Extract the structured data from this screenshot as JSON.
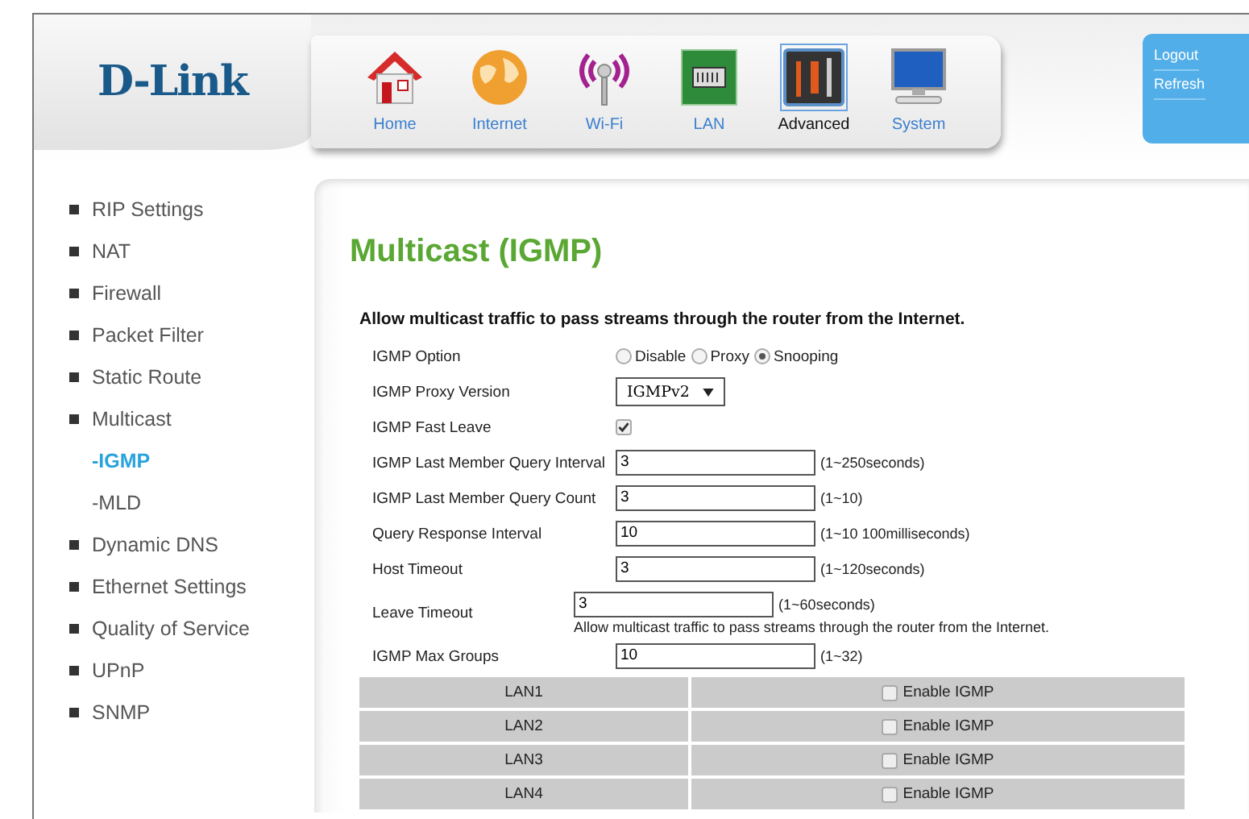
{
  "logo": "D-Link",
  "nav": [
    {
      "kind": "home",
      "label": "Home",
      "selected": false
    },
    {
      "kind": "internet",
      "label": "Internet",
      "selected": false
    },
    {
      "kind": "wifi",
      "label": "Wi-Fi",
      "selected": false
    },
    {
      "kind": "lan",
      "label": "LAN",
      "selected": false
    },
    {
      "kind": "advanced",
      "label": "Advanced",
      "selected": true
    },
    {
      "kind": "system",
      "label": "System",
      "selected": false
    }
  ],
  "account_links": [
    "Logout",
    "Refresh"
  ],
  "sidebar": {
    "items": [
      {
        "label": "RIP Settings",
        "selected": false
      },
      {
        "label": "NAT",
        "selected": false
      },
      {
        "label": "Firewall",
        "selected": false
      },
      {
        "label": "Packet Filter",
        "selected": false
      },
      {
        "label": "Static Route",
        "selected": false
      },
      {
        "label": "Multicast",
        "selected": false,
        "children": [
          {
            "label": "-IGMP",
            "selected": true
          },
          {
            "label": "-MLD",
            "selected": false
          }
        ]
      },
      {
        "label": "Dynamic DNS",
        "selected": false
      },
      {
        "label": "Ethernet Settings",
        "selected": false
      },
      {
        "label": "Quality of Service",
        "selected": false
      },
      {
        "label": "UPnP",
        "selected": false
      },
      {
        "label": "SNMP",
        "selected": false
      }
    ]
  },
  "page_title": "Multicast (IGMP)",
  "description": "Allow multicast traffic to pass streams through the router from the Internet.",
  "form": {
    "rows": [
      {
        "kind": "radio",
        "label": "IGMP Option",
        "options": [
          {
            "label": "Disable",
            "selected": false
          },
          {
            "label": "Proxy",
            "selected": false
          },
          {
            "label": "Snooping",
            "selected": true
          }
        ]
      },
      {
        "kind": "select",
        "label": "IGMP Proxy Version",
        "value": "IGMPv2"
      },
      {
        "kind": "checkbox",
        "label": "IGMP Fast Leave",
        "checked": true
      },
      {
        "kind": "text",
        "label": "IGMP Last Member Query Interval",
        "value": "3",
        "hint": "(1~250seconds)"
      },
      {
        "kind": "text",
        "label": "IGMP Last Member Query Count",
        "value": "3",
        "hint": "(1~10)"
      },
      {
        "kind": "text",
        "label": "Query Response Interval",
        "value": "10",
        "hint": "(1~10 100milliseconds)"
      },
      {
        "kind": "text",
        "label": "Host Timeout",
        "value": "3",
        "hint": "(1~120seconds)"
      },
      {
        "kind": "text",
        "label": "Leave Timeout",
        "value": "3",
        "hint": "(1~60seconds)",
        "note": "Allow multicast traffic to pass streams through the router from the Internet."
      },
      {
        "kind": "text",
        "label": "IGMP Max Groups",
        "value": "10",
        "hint": "(1~32)"
      }
    ]
  },
  "lan_table": {
    "rows": [
      {
        "port": "LAN1",
        "option": {
          "label": "Enable IGMP",
          "checked": false
        }
      },
      {
        "port": "LAN2",
        "option": {
          "label": "Enable IGMP",
          "checked": false
        }
      },
      {
        "port": "LAN3",
        "option": {
          "label": "Enable IGMP",
          "checked": false
        }
      },
      {
        "port": "LAN4",
        "option": {
          "label": "Enable IGMP",
          "checked": false
        }
      }
    ]
  }
}
